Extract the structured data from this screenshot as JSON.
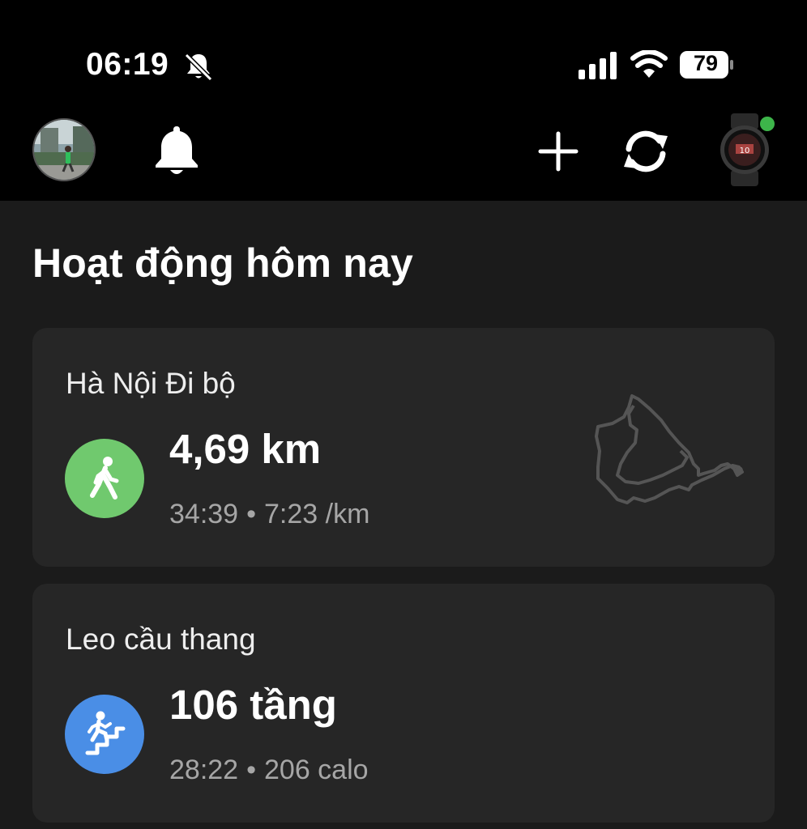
{
  "status_bar": {
    "time": "06:19",
    "battery": "79"
  },
  "toolbar": {
    "icons": [
      "profile-avatar",
      "notification-bell-icon",
      "plus-icon",
      "sync-icon",
      "watch-device"
    ]
  },
  "page": {
    "title": "Hoạt động hôm nay"
  },
  "activities": [
    {
      "label": "Hà Nội Đi bộ",
      "main_value": "4,69 km",
      "duration": "34:39",
      "separator": "•",
      "secondary": "7:23 /km",
      "icon": "walking-icon",
      "color": "#70c96e"
    },
    {
      "label": "Leo cầu thang",
      "main_value": "106 tầng",
      "duration": "28:22",
      "separator": "•",
      "secondary": "206 calo",
      "icon": "stairs-climbing-icon",
      "color": "#4a8ee6"
    }
  ]
}
